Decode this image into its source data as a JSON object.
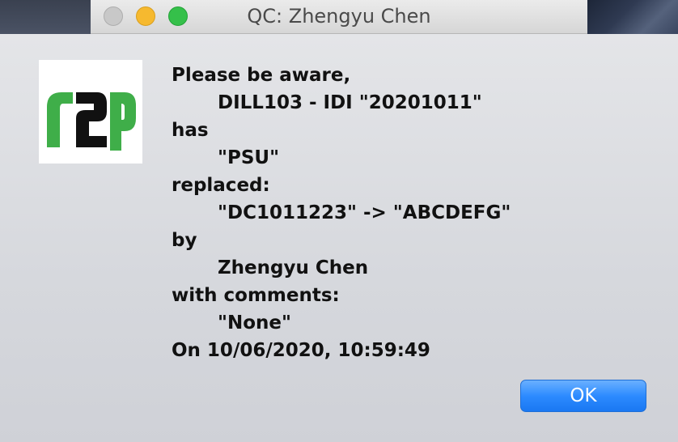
{
  "window": {
    "title": "QC: Zhengyu Chen"
  },
  "logo": {
    "name": "r2p-logo",
    "text": "r2p",
    "colors": {
      "r": "#3fae49",
      "2": "#111111",
      "p": "#3fae49"
    }
  },
  "message": {
    "lines": [
      {
        "text": "Please be aware,",
        "indent": false
      },
      {
        "text": "DILL103 - IDI \"20201011\"",
        "indent": true
      },
      {
        "text": "has",
        "indent": false
      },
      {
        "text": "\"PSU\"",
        "indent": true
      },
      {
        "text": "replaced:",
        "indent": false
      },
      {
        "text": "\"DC1011223\" -> \"ABCDEFG\"",
        "indent": true
      },
      {
        "text": "by",
        "indent": false
      },
      {
        "text": "Zhengyu Chen",
        "indent": true
      },
      {
        "text": "with comments:",
        "indent": false
      },
      {
        "text": "\"None\"",
        "indent": true
      },
      {
        "text": "On 10/06/2020, 10:59:49",
        "indent": false
      }
    ]
  },
  "buttons": {
    "ok_label": "OK"
  },
  "colors": {
    "accent": "#2d8bff",
    "close": "#c8c8c8",
    "minimize": "#f6b92f",
    "maximize": "#35c04a"
  }
}
